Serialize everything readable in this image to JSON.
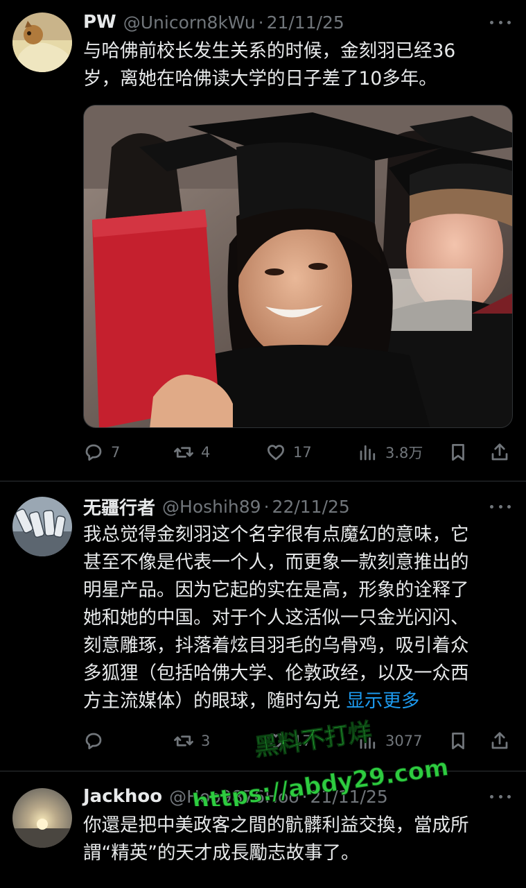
{
  "tweets": [
    {
      "name": "PW",
      "handle": "@Unicorn8kWu",
      "sep": "·",
      "date": "21/11/25",
      "lines": [
        "与哈佛前校长发生关系的时候，金刻羽已经36",
        "岁，离她在哈佛读大学的日子差了10多年。"
      ],
      "counts": {
        "reply": "7",
        "retweet": "4",
        "like": "17",
        "views": "3.8万"
      }
    },
    {
      "name": "无疆行者",
      "handle": "@Hoshih89",
      "sep": "·",
      "date": "22/11/25",
      "lines": [
        "我总觉得金刻羽这个名字很有点魔幻的意味，它",
        "甚至不像是代表一个人，而更象一款刻意推出的",
        "明星产品。因为它起的实在是高，形象的诠释了",
        "她和她的中国。对于个人这活似一只金光闪闪、",
        "刻意雕琢，抖落着炫目羽毛的乌骨鸡，吸引着众",
        "多狐狸（包括哈佛大学、伦敦政经，以及一众西",
        "方主流媒体）的眼球，随时勾兑"
      ],
      "show_more": "显示更多",
      "counts": {
        "reply": "",
        "retweet": "3",
        "like": "17",
        "views": "3077"
      }
    },
    {
      "name": "Jackhoo",
      "handle": "@Hoo9876Hoo",
      "sep": "·",
      "date": "21/11/25",
      "lines": [
        "你還是把中美政客之間的骯髒利益交換，當成所",
        "謂“精英”的天才成長勵志故事了。"
      ]
    }
  ],
  "watermark": {
    "line1": "黑料不打烊",
    "line2": "https://abdy29.com"
  },
  "icons": [
    "reply-icon",
    "retweet-icon",
    "like-icon",
    "views-icon",
    "bookmark-icon",
    "share-icon",
    "more-icon"
  ],
  "colors": {
    "background": "#000000",
    "text": "#e7e9ea",
    "muted": "#71767b",
    "link": "#1d9bf0",
    "divider": "#2f3336",
    "watermark": "#2ecc40"
  }
}
